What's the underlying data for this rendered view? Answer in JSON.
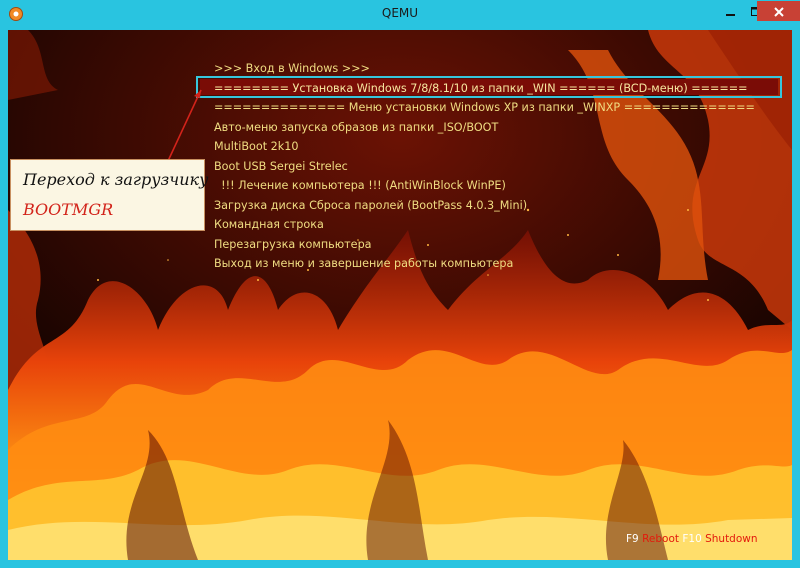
{
  "window": {
    "title": "QEMU"
  },
  "menu": {
    "items": [
      {
        "label": ">>> Вход в Windows >>>"
      },
      {
        "label": "======== Установка Windows 7/8/8.1/10 из папки _WIN ====== (BCD-меню) ======"
      },
      {
        "label": "============== Меню установки Windows XP из папки _WINXP =============="
      },
      {
        "label": "Авто-меню запуска образов из папки _ISO/BOOT"
      },
      {
        "label": "MultiBoot 2k10"
      },
      {
        "label": "Boot USB Sergei Strelec"
      },
      {
        "label": "  !!! Лечение компьютера !!! (AntiWinBlock WinPE)"
      },
      {
        "label": "Загрузка диска Сброса паролей (BootPass 4.0.3_Mini)"
      },
      {
        "label": "Командная строка"
      },
      {
        "label": "Перезагрузка компьютера"
      },
      {
        "label": "Выход из меню и завершение работы компьютера"
      }
    ],
    "selected_index": 1
  },
  "callout": {
    "line1": "Переход к загрузчику",
    "line2": "BOOTMGR"
  },
  "fkeys": {
    "f9_key": "F9",
    "f9_action": "Reboot",
    "f10_key": "F10",
    "f10_action": "Shutdown"
  },
  "colors": {
    "menu_text": "#f0dd82",
    "selection_bar": "#7a0c06",
    "highlight_border": "#36c6dc",
    "callout_accent": "#d2231a",
    "window_frame": "#29c4e0"
  }
}
